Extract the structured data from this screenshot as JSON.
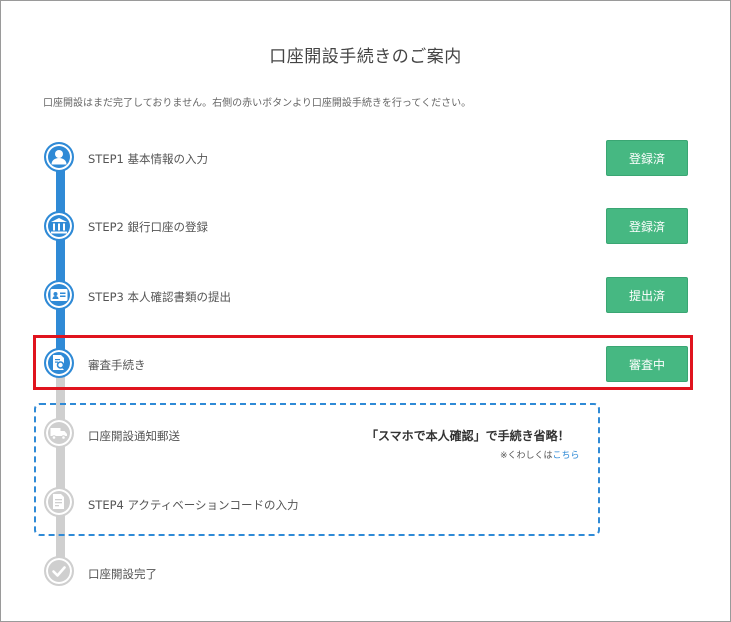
{
  "title": "口座開設手続きのご案内",
  "notice": "口座開設はまだ完了しておりません。右側の赤いボタンより口座開設手続きを行ってください。",
  "colors": {
    "blue": "#2f8ad6",
    "green": "#46b882",
    "gray": "#cfcfcf",
    "highlight": "#e0141e"
  },
  "steps": [
    {
      "label": "STEP1 基本情報の入力",
      "status": "登録済",
      "icon": "person-icon",
      "state": "done"
    },
    {
      "label": "STEP2 銀行口座の登録",
      "status": "登録済",
      "icon": "bank-icon",
      "state": "done"
    },
    {
      "label": "STEP3 本人確認書類の提出",
      "status": "提出済",
      "icon": "id-card-icon",
      "state": "done"
    },
    {
      "label": "審査手続き",
      "status": "審査中",
      "icon": "document-search-icon",
      "state": "current"
    },
    {
      "label": "口座開設通知郵送",
      "icon": "truck-icon",
      "state": "pending"
    },
    {
      "label": "STEP4 アクティベーションコードの入力",
      "icon": "form-icon",
      "state": "pending"
    },
    {
      "label": "口座開設完了",
      "icon": "check-icon",
      "state": "pending"
    }
  ],
  "promo": {
    "headline": "「スマホで本人確認」で手続き省略！",
    "note_prefix": "※くわしくは",
    "note_link": "こちら"
  }
}
